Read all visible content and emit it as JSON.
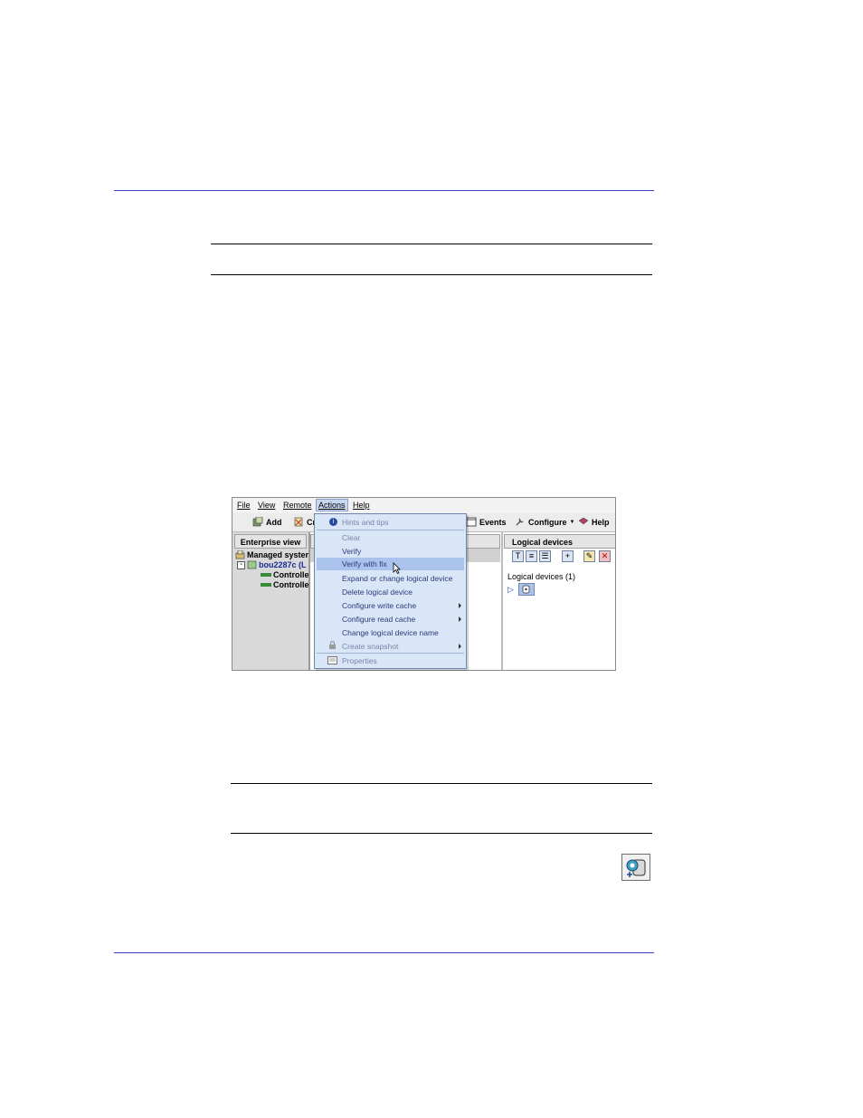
{
  "screenshot": {
    "menubar": [
      "File",
      "View",
      "Remote",
      "Actions",
      "Help"
    ],
    "toolbar": {
      "add": "Add",
      "create_partial": "Cr",
      "events": "Events",
      "configure": "Configure",
      "help": "Help"
    },
    "left_panel": {
      "header": "Enterprise view",
      "tree": [
        "Managed syster",
        "bou2287c (L",
        "Controlle",
        "Controlle"
      ]
    },
    "right_panel": {
      "header": "Logical devices",
      "group_label": "Logical devices (1)"
    },
    "actions_menu": {
      "items": [
        "Hints and tips",
        "Clear",
        "Verify",
        "Verify with fix",
        "Expand or change logical device",
        "Delete logical device",
        "Configure write cache",
        "Configure read cache",
        "Change logical device name",
        "Create snapshot",
        "Properties"
      ],
      "highlighted": "Verify with fix"
    }
  },
  "colors": {
    "section_rule": "#3a3ac8",
    "menu_bg": "#d8e6f7",
    "menu_highlight": "#a9c3ec"
  },
  "icons": {
    "side_icon": "logical-device-verify-icon"
  }
}
